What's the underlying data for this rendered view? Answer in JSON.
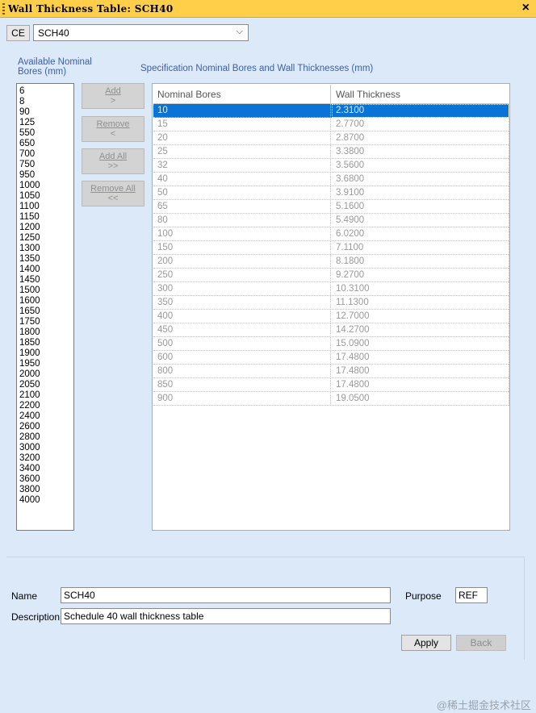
{
  "window": {
    "title": "Wall Thickness Table: SCH40",
    "close_glyph": "×"
  },
  "toolbar": {
    "ce_label": "CE",
    "table_select_value": "SCH40",
    "select_arrow": "⌵"
  },
  "available": {
    "label_line1": "Available Nominal",
    "label_line2": "Bores (mm)",
    "items": [
      "6",
      "8",
      "90",
      "125",
      "550",
      "650",
      "700",
      "750",
      "950",
      "1000",
      "1050",
      "1100",
      "1150",
      "1200",
      "1250",
      "1300",
      "1350",
      "1400",
      "1450",
      "1500",
      "1600",
      "1650",
      "1750",
      "1800",
      "1850",
      "1900",
      "1950",
      "2000",
      "2050",
      "2100",
      "2200",
      "2400",
      "2600",
      "2800",
      "3000",
      "3200",
      "3400",
      "3600",
      "3800",
      "4000"
    ]
  },
  "buttons": {
    "add": {
      "line1": "Add",
      "line2": ">"
    },
    "remove": {
      "line1": "Remove",
      "line2": "<"
    },
    "add_all": {
      "line1": "Add All",
      "line2": ">>"
    },
    "remove_all": {
      "line1": "Remove All",
      "line2": "<<"
    }
  },
  "spec": {
    "label": "Specification Nominal Bores and Wall Thicknesses (mm)",
    "columns": [
      "Nominal Bores",
      "Wall Thickness"
    ],
    "selected_index": 0,
    "rows": [
      [
        "10",
        "2.3100"
      ],
      [
        "15",
        "2.7700"
      ],
      [
        "20",
        "2.8700"
      ],
      [
        "25",
        "3.3800"
      ],
      [
        "32",
        "3.5600"
      ],
      [
        "40",
        "3.6800"
      ],
      [
        "50",
        "3.9100"
      ],
      [
        "65",
        "5.1600"
      ],
      [
        "80",
        "5.4900"
      ],
      [
        "100",
        "6.0200"
      ],
      [
        "150",
        "7.1100"
      ],
      [
        "200",
        "8.1800"
      ],
      [
        "250",
        "9.2700"
      ],
      [
        "300",
        "10.3100"
      ],
      [
        "350",
        "11.1300"
      ],
      [
        "400",
        "12.7000"
      ],
      [
        "450",
        "14.2700"
      ],
      [
        "500",
        "15.0900"
      ],
      [
        "600",
        "17.4800"
      ],
      [
        "800",
        "17.4800"
      ],
      [
        "850",
        "17.4800"
      ],
      [
        "900",
        "19.0500"
      ]
    ]
  },
  "form": {
    "name_label": "Name",
    "name_value": "SCH40",
    "purpose_label": "Purpose",
    "purpose_value": "REF",
    "description_label": "Description",
    "description_value": "Schedule 40 wall thickness table",
    "apply_label": "Apply",
    "back_label": "Back"
  },
  "watermark": "@稀土掘金技术社区",
  "colors": {
    "titlebar": "#ffcf4a",
    "background": "#dce9f9",
    "selection": "#0a74d6",
    "label_blue": "#3d5fa8"
  }
}
